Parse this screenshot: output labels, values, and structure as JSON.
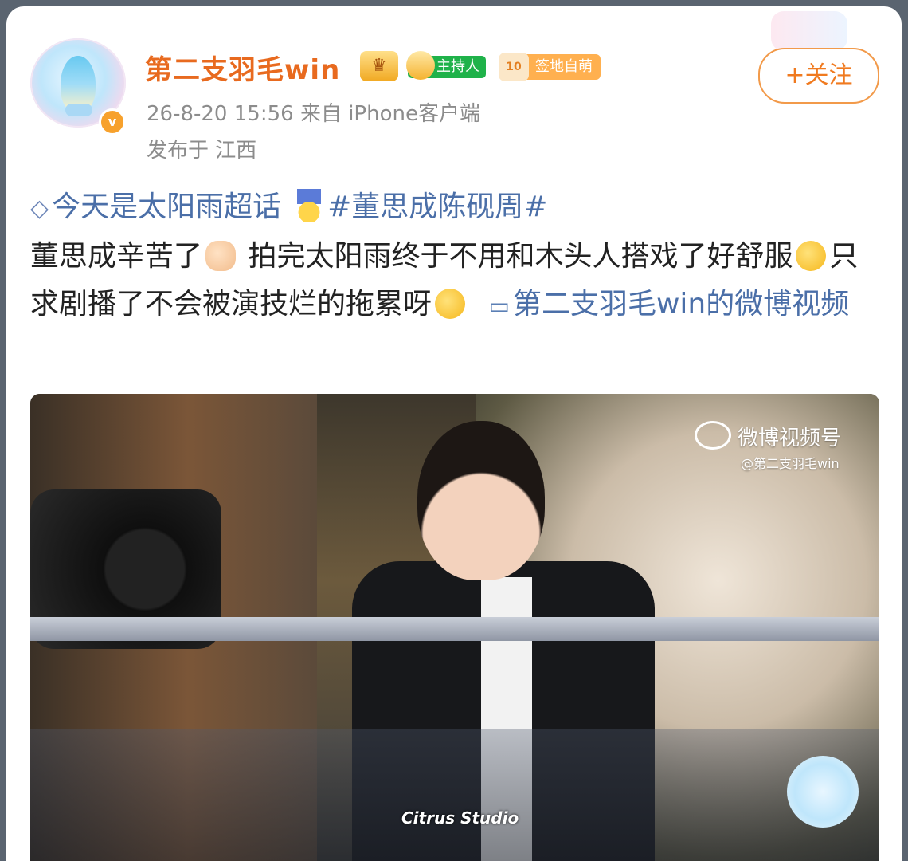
{
  "post": {
    "username": "第二支羽毛win",
    "badge_host": "主持人",
    "badge_sign": "签地自萌",
    "badge_sign_level": "10",
    "timestamp": "26-8-20 15:56",
    "source": "来自 iPhone客户端",
    "location": "发布于 江西",
    "follow_label": "+关注",
    "verified_mark": "v"
  },
  "content": {
    "supertopic": "今天是太阳雨超话",
    "hashtag": "#董思成陈砚周#",
    "line1": "董思成辛苦了",
    "line2": "拍完太阳雨终于不用和木头人搭戏了好舒服",
    "line3": "只求剧播了不会被演技烂的拖累呀",
    "video_link": "第二支羽毛win的微博视频"
  },
  "media": {
    "watermark_title": "微博视频号",
    "watermark_user": "@第二支羽毛win",
    "watermark_bottom": "Citrus Studio"
  },
  "colors": {
    "username": "#e86a1f",
    "link": "#4b6fa8",
    "follow": "#f07a1f",
    "meta": "#8c8c8c"
  },
  "icons": [
    "verified-icon",
    "crown-badge-icon",
    "host-badge-icon",
    "sign-badge-icon",
    "diamond-icon",
    "medal-icon",
    "finger-heart-emoji",
    "smile-emoji",
    "hug-emoji",
    "video-icon",
    "weibo-logo-icon"
  ]
}
